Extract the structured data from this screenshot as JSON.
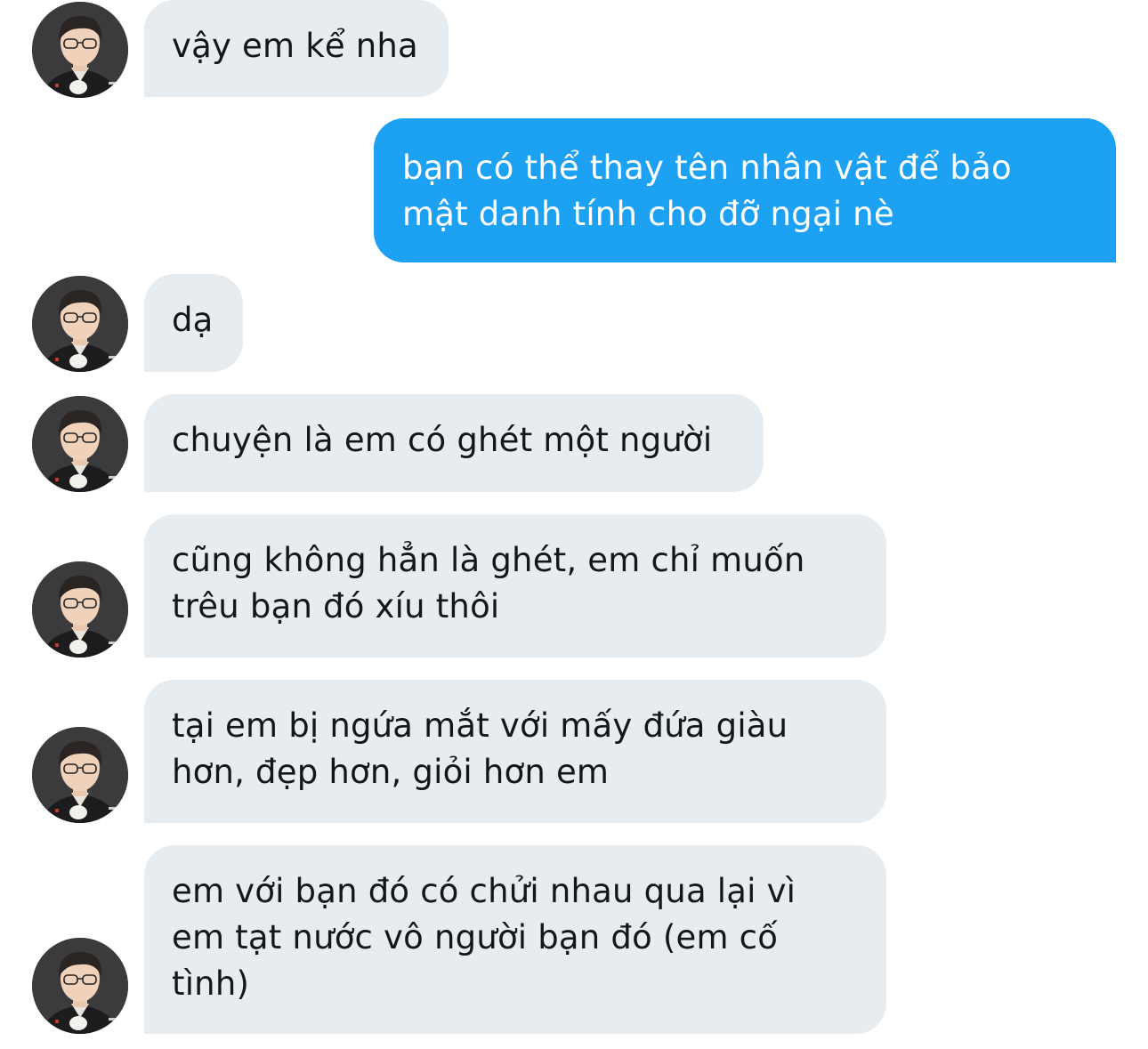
{
  "conversation": {
    "messages": [
      {
        "sender": "them",
        "lines": [
          "vậy em kể nha"
        ]
      },
      {
        "sender": "me",
        "lines": [
          "bạn có thể thay tên nhân vật để bảo",
          "mật danh tính cho đỡ ngại nè"
        ]
      },
      {
        "sender": "them",
        "lines": [
          "dạ"
        ]
      },
      {
        "sender": "them",
        "lines": [
          "chuyện là em có ghét một người"
        ]
      },
      {
        "sender": "them",
        "lines": [
          "cũng không hẳn là ghét, em chỉ muốn",
          "trêu bạn đó xíu thôi"
        ]
      },
      {
        "sender": "them",
        "lines": [
          "tại em bị ngứa mắt với mấy đứa giàu",
          "hơn, đẹp hơn, giỏi hơn em"
        ]
      },
      {
        "sender": "them",
        "lines": [
          "em với bạn đó có chửi nhau qua lại vì",
          "em tạt nước vô người bạn đó (em cố",
          "tình)"
        ]
      }
    ]
  },
  "colors": {
    "incoming_bubble": "#e6ecf0",
    "outgoing_bubble": "#1da1f2",
    "incoming_text": "#14171a",
    "outgoing_text": "#ffffff"
  },
  "icons": {
    "avatar": "user-avatar-photo"
  }
}
